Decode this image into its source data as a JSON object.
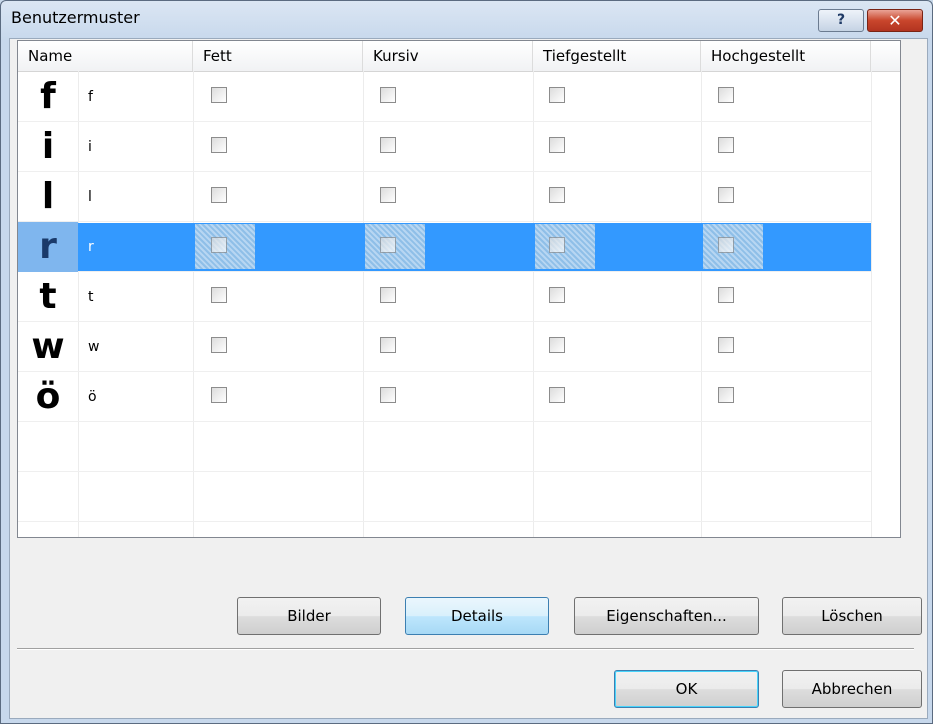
{
  "window": {
    "title": "Benutzermuster",
    "help_glyph": "?",
    "close_glyph": "✕"
  },
  "listview": {
    "columns": [
      "Name",
      "Fett",
      "Kursiv",
      "Tiefgestellt",
      "Hochgestellt"
    ],
    "rows": [
      {
        "symbol": "f",
        "char": "f",
        "fett": false,
        "kursiv": false,
        "tief": false,
        "hoch": false,
        "selected": false
      },
      {
        "symbol": "i",
        "char": "i",
        "fett": false,
        "kursiv": false,
        "tief": false,
        "hoch": false,
        "selected": false
      },
      {
        "symbol": "l",
        "char": "l",
        "fett": false,
        "kursiv": false,
        "tief": false,
        "hoch": false,
        "selected": false
      },
      {
        "symbol": "r",
        "char": "r",
        "fett": false,
        "kursiv": false,
        "tief": false,
        "hoch": false,
        "selected": true
      },
      {
        "symbol": "t",
        "char": "t",
        "fett": false,
        "kursiv": false,
        "tief": false,
        "hoch": false,
        "selected": false
      },
      {
        "symbol": "w",
        "char": "w",
        "fett": false,
        "kursiv": false,
        "tief": false,
        "hoch": false,
        "selected": false
      },
      {
        "symbol": "ö",
        "char": "ö",
        "fett": false,
        "kursiv": false,
        "tief": false,
        "hoch": false,
        "selected": false
      }
    ]
  },
  "buttons": {
    "bilder": "Bilder",
    "details": "Details",
    "eigenschaften": "Eigenschaften...",
    "loeschen": "Löschen",
    "ok": "OK",
    "abbrechen": "Abbrechen"
  },
  "colors": {
    "selection": "#3399ff",
    "title_bar": "#c7d8ec",
    "close_button": "#c9462c"
  }
}
